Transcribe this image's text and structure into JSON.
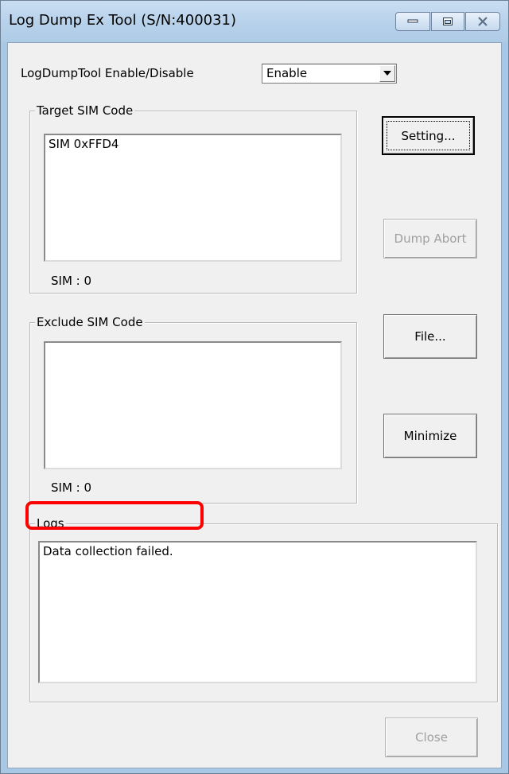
{
  "window": {
    "title": "Log Dump Ex Tool (S/N:400031)",
    "caption_buttons": {
      "minimize_icon": "minimize-icon",
      "maximize_icon": "maximize-icon",
      "close_icon": "close-icon"
    }
  },
  "enable_row": {
    "label": "LogDumpTool Enable/Disable",
    "selected_value": "Enable"
  },
  "target_sim": {
    "group_title": "Target SIM Code",
    "items": [
      "SIM 0xFFD4"
    ],
    "count_text": "SIM : 0"
  },
  "exclude_sim": {
    "group_title": "Exclude SIM Code",
    "items": [],
    "count_text": "SIM : 0"
  },
  "logs": {
    "group_title": "Logs",
    "lines": [
      "Data collection failed."
    ]
  },
  "buttons": {
    "setting": "Setting...",
    "dump_abort": "Dump Abort",
    "file": "File...",
    "minimize": "Minimize",
    "close": "Close"
  },
  "colors": {
    "highlight": "#ff0000",
    "dialog_background": "#f0f0f0",
    "disabled_text": "#a0a0a0"
  }
}
